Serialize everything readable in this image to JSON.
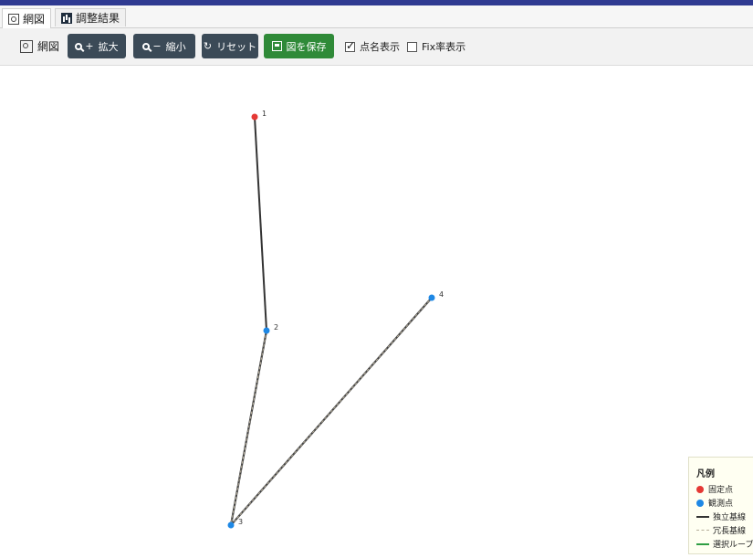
{
  "tabs": [
    {
      "label": "網図",
      "icon": "network-icon",
      "active": true
    },
    {
      "label": "調整結果",
      "icon": "chart-icon",
      "active": false
    }
  ],
  "toolbar": {
    "title": "網図",
    "zoom_in": "拡大",
    "zoom_out": "縮小",
    "reset": "リセット",
    "save": "図を保存",
    "show_names": {
      "label": "点名表示",
      "checked": true
    },
    "show_fix": {
      "label": "Fix率表示",
      "checked": false
    }
  },
  "colors": {
    "fixed_point": "#e53935",
    "observed_point": "#1e88e5",
    "independent_baseline": "#333333",
    "redundant_baseline": "#b5ad9a",
    "selected_loop": "#2f9e44",
    "toolbar_button": "#3b4a57",
    "save_button": "#2f8a38"
  },
  "network": {
    "points": [
      {
        "name": "1",
        "kind": "fixed"
      },
      {
        "name": "2",
        "kind": "observed"
      },
      {
        "name": "3",
        "kind": "observed"
      },
      {
        "name": "4",
        "kind": "observed"
      }
    ],
    "baselines": [
      {
        "from": "1",
        "to": "2",
        "kind": "independent"
      },
      {
        "from": "2",
        "to": "3",
        "kind": "redundant"
      },
      {
        "from": "3",
        "to": "4",
        "kind": "redundant"
      }
    ]
  },
  "legend": {
    "title": "凡例",
    "items": [
      {
        "label": "固定点",
        "type": "dot",
        "color": "#e53935"
      },
      {
        "label": "観測点",
        "type": "dot",
        "color": "#1e88e5"
      },
      {
        "label": "独立基線",
        "type": "solid",
        "color": "#333333"
      },
      {
        "label": "冗長基線",
        "type": "dashed",
        "color": "#b5ad9a"
      },
      {
        "label": "選択ループ",
        "type": "solid",
        "color": "#2f9e44"
      }
    ]
  }
}
